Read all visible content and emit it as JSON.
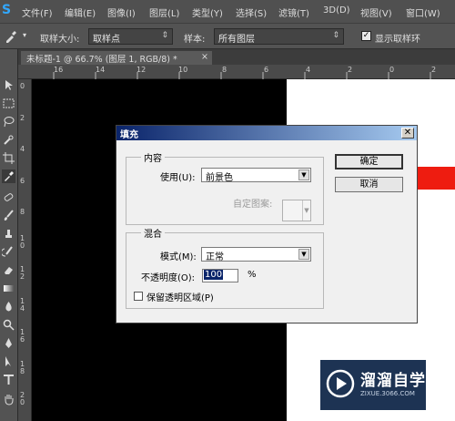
{
  "app": {
    "logo": "S"
  },
  "menu": [
    "文件(F)",
    "编辑(E)",
    "图像(I)",
    "图层(L)",
    "类型(Y)",
    "选择(S)",
    "滤镜(T)",
    "3D(D)",
    "视图(V)",
    "窗口(W)"
  ],
  "options": {
    "sample_size_label": "取样大小:",
    "sample_size_value": "取样点",
    "sample_label": "样本:",
    "sample_value": "所有图层",
    "show_ring_label": "显示取样环",
    "show_ring_checked": true
  },
  "tab": {
    "title": "未标题-1 @ 66.7% (图层 1, RGB/8) *",
    "close": "×"
  },
  "ruler": {
    "top": [
      "16",
      "14",
      "12",
      "10",
      "8",
      "6",
      "4",
      "2",
      "0",
      "2"
    ],
    "left": [
      "0",
      "2",
      "4",
      "6",
      "8",
      "1 0",
      "1 2",
      "1 4",
      "1 6",
      "1 8",
      "2 0"
    ]
  },
  "dialog": {
    "title": "填充",
    "close": "✕",
    "content_group": "内容",
    "use_label": "使用(U):",
    "use_value": "前景色",
    "custom_pattern_label": "自定图案:",
    "blend_group": "混合",
    "mode_label": "模式(M):",
    "mode_value": "正常",
    "opacity_label": "不透明度(O):",
    "opacity_value": "100",
    "opacity_unit": "%",
    "preserve_label": "保留透明区域(P)",
    "preserve_checked": false,
    "ok_label": "确定",
    "cancel_label": "取消"
  },
  "watermark": {
    "main": "溜溜自学",
    "sub": "ZIXUE.3066.COM"
  },
  "colors": {
    "accent_red": "#ee1c10",
    "dialog_title": "#0a246a",
    "watermark_bg": "#1d3353"
  }
}
